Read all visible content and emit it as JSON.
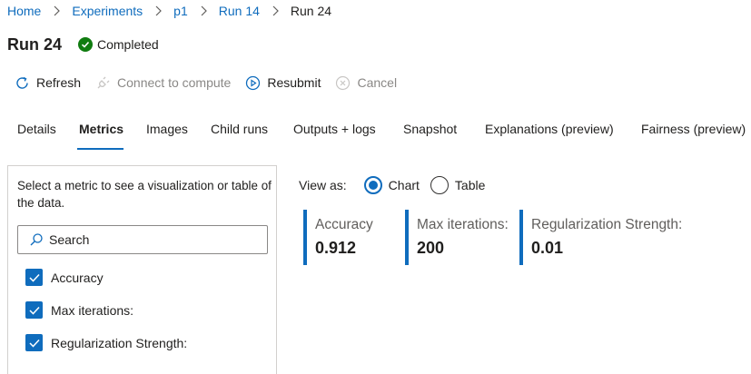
{
  "breadcrumb": {
    "items": [
      "Home",
      "Experiments",
      "p1",
      "Run 14"
    ],
    "current": "Run 24"
  },
  "header": {
    "title": "Run 24",
    "status": "Completed",
    "status_color": "#107c10"
  },
  "commands": {
    "refresh": "Refresh",
    "connect": "Connect to compute",
    "resubmit": "Resubmit",
    "cancel": "Cancel"
  },
  "tabs": [
    {
      "label": "Details"
    },
    {
      "label": "Metrics"
    },
    {
      "label": "Images"
    },
    {
      "label": "Child runs"
    },
    {
      "label": "Outputs + logs"
    },
    {
      "label": "Snapshot"
    },
    {
      "label": "Explanations (preview)"
    },
    {
      "label": "Fairness (preview)"
    }
  ],
  "active_tab": "Metrics",
  "metric_panel": {
    "description": "Select a metric to see a visualization or table of the data.",
    "search_placeholder": "Search",
    "metrics": [
      {
        "label": "Accuracy",
        "checked": true
      },
      {
        "label": "Max iterations:",
        "checked": true
      },
      {
        "label": "Regularization Strength:",
        "checked": true
      }
    ]
  },
  "view_as": {
    "label": "View as:",
    "options": [
      "Chart",
      "Table"
    ],
    "selected": "Chart"
  },
  "metric_cards": [
    {
      "label": "Accuracy",
      "value": "0.912"
    },
    {
      "label": "Max iterations:",
      "value": "200"
    },
    {
      "label": "Regularization Strength:",
      "value": "0.01"
    }
  ],
  "colors": {
    "accent": "#0f6cbd",
    "success": "#107c10",
    "disabled_text": "#8a8886"
  },
  "icons": [
    "chevron-right-icon",
    "checkmark-icon",
    "refresh-icon",
    "plug-icon",
    "play-circle-icon",
    "cancel-icon",
    "search-icon",
    "checkbox-check-icon"
  ]
}
